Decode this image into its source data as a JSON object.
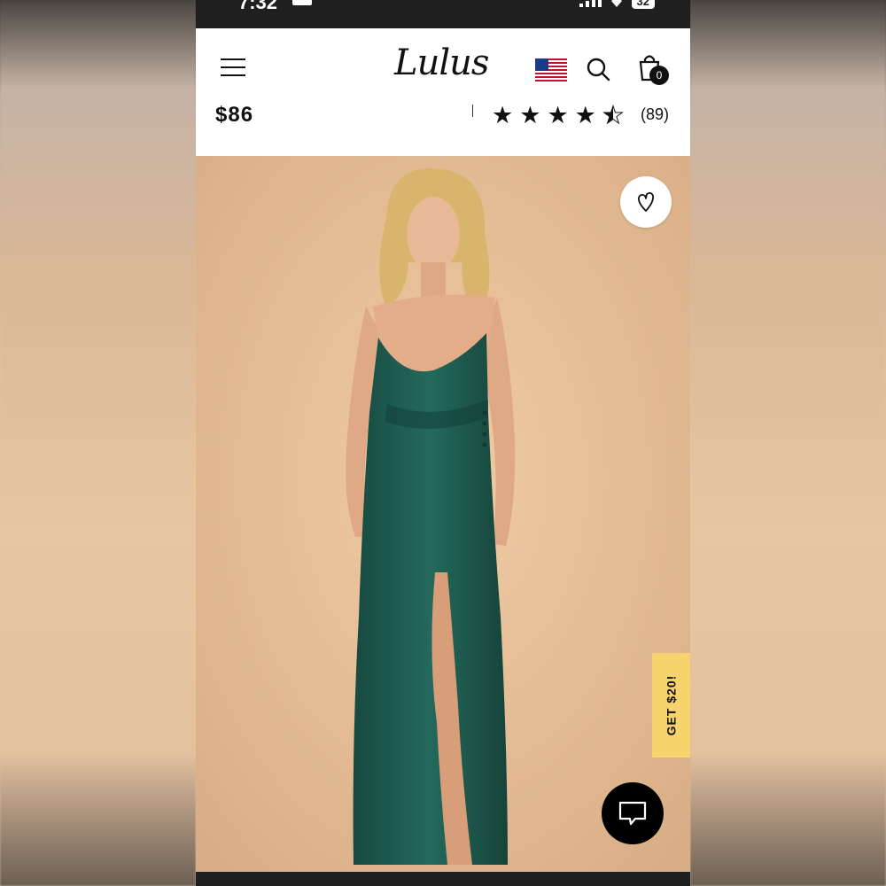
{
  "status_bar": {
    "time": "7:32",
    "battery": "32"
  },
  "header": {
    "logo": "Lulus",
    "cart_count": "0",
    "icons": [
      "menu-icon",
      "us-flag-icon",
      "search-icon",
      "shopping-bag-icon"
    ]
  },
  "product": {
    "price": "$86",
    "rating": 4.5,
    "rating_max": 5,
    "review_count": "(89)",
    "dress_color": "#1f5e52",
    "background_color": "#e5be97"
  },
  "overlays": {
    "promo_label": "GET $20!",
    "promo_color": "#f6d36d",
    "wishlist_icon": "heart-icon",
    "chat_icon": "chat-bubble-icon"
  }
}
